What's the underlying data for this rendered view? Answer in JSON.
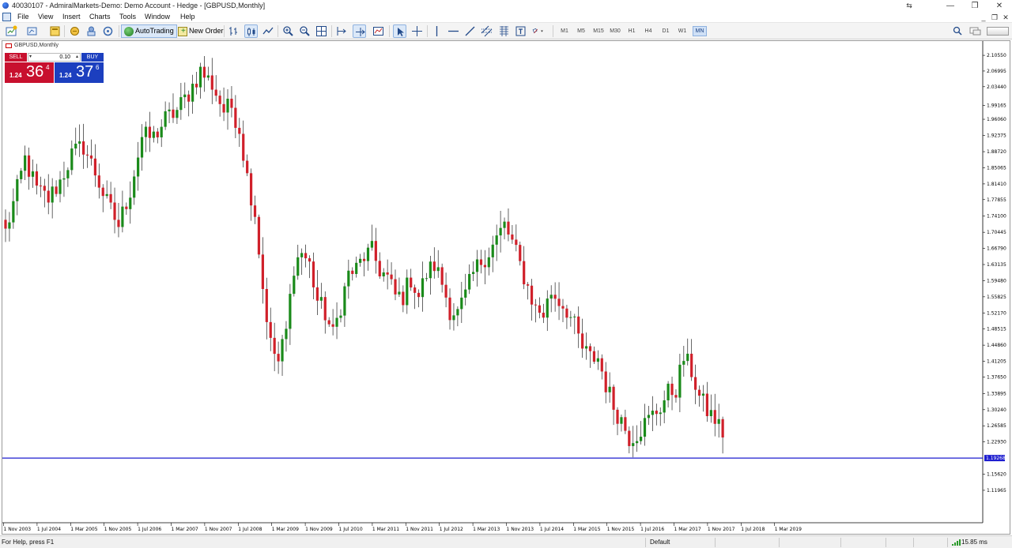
{
  "window": {
    "title": "40030107 - AdmiralMarkets-Demo: Demo Account - Hedge - [GBPUSD,Monthly]",
    "minimize": "—",
    "restore": "❐",
    "close": "✕"
  },
  "menu": {
    "items": [
      "File",
      "View",
      "Insert",
      "Charts",
      "Tools",
      "Window",
      "Help"
    ],
    "mdi_minimize": "_",
    "mdi_restore": "❐",
    "mdi_close": "✕"
  },
  "toolbar": {
    "autotrading_label": "AutoTrading",
    "new_order_label": "New Order",
    "timeframes": [
      "M1",
      "M5",
      "M15",
      "M30",
      "H1",
      "H4",
      "D1",
      "W1",
      "MN"
    ],
    "active_timeframe": "MN"
  },
  "chart_window": {
    "label": "GBPUSD,Monthly",
    "symbol": "GBPUSD",
    "period": "Monthly"
  },
  "one_click": {
    "sell_label": "SELL",
    "buy_label": "BUY",
    "lot": "0.10",
    "sell_price_small": "1.24",
    "sell_price_big": "36",
    "sell_price_sup": "4",
    "buy_price_small": "1.24",
    "buy_price_big": "37",
    "buy_price_sup": "6"
  },
  "chart_data": {
    "type": "candlestick",
    "y_ticks": [
      "2.10550",
      "2.06995",
      "2.03440",
      "1.99165",
      "1.96060",
      "1.92375",
      "1.88720",
      "1.85065",
      "1.81410",
      "1.77855",
      "1.74100",
      "1.70445",
      "1.66790",
      "1.63135",
      "1.59480",
      "1.55825",
      "1.52170",
      "1.48515",
      "1.44860",
      "1.41205",
      "1.37650",
      "1.33895",
      "1.30240",
      "1.26585",
      "1.22930",
      "1.15620",
      "1.11965"
    ],
    "ylim": [
      1.1034,
      2.1128
    ],
    "x_ticks": [
      "1 Nov 2003",
      "1 Jul 2004",
      "1 Mar 2005",
      "1 Nov 2005",
      "1 Jul 2006",
      "1 Mar 2007",
      "1 Nov 2007",
      "1 Jul 2008",
      "1 Mar 2009",
      "1 Nov 2009",
      "1 Jul 2010",
      "1 Mar 2011",
      "1 Nov 2011",
      "1 Jul 2012",
      "1 Mar 2013",
      "1 Nov 2013",
      "1 Jul 2014",
      "1 Mar 2015",
      "1 Nov 2015",
      "1 Jul 2016",
      "1 Mar 2017",
      "1 Nov 2017",
      "1 Jul 2018",
      "1 Mar 2019"
    ],
    "current_price": "1.19268",
    "current_price_value": 1.19268,
    "candle_count": 185,
    "anchor_closes": [
      [
        0,
        1.705
      ],
      [
        3,
        1.8
      ],
      [
        5,
        1.87
      ],
      [
        8,
        1.8
      ],
      [
        11,
        1.78
      ],
      [
        14,
        1.82
      ],
      [
        17,
        1.88
      ],
      [
        20,
        1.9
      ],
      [
        23,
        1.84
      ],
      [
        26,
        1.77
      ],
      [
        29,
        1.72
      ],
      [
        32,
        1.8
      ],
      [
        35,
        1.92
      ],
      [
        38,
        1.92
      ],
      [
        41,
        1.96
      ],
      [
        44,
        1.98
      ],
      [
        47,
        2.02
      ],
      [
        50,
        2.07
      ],
      [
        53,
        2.04
      ],
      [
        56,
        1.98
      ],
      [
        58,
        1.99
      ],
      [
        60,
        1.94
      ],
      [
        62,
        1.83
      ],
      [
        64,
        1.75
      ],
      [
        66,
        1.58
      ],
      [
        68,
        1.45
      ],
      [
        70,
        1.41
      ],
      [
        72,
        1.48
      ],
      [
        74,
        1.63
      ],
      [
        76,
        1.66
      ],
      [
        78,
        1.63
      ],
      [
        80,
        1.55
      ],
      [
        82,
        1.52
      ],
      [
        84,
        1.47
      ],
      [
        86,
        1.54
      ],
      [
        88,
        1.61
      ],
      [
        90,
        1.62
      ],
      [
        92,
        1.65
      ],
      [
        94,
        1.66
      ],
      [
        96,
        1.62
      ],
      [
        98,
        1.6
      ],
      [
        100,
        1.56
      ],
      [
        102,
        1.56
      ],
      [
        104,
        1.6
      ],
      [
        106,
        1.56
      ],
      [
        108,
        1.61
      ],
      [
        110,
        1.63
      ],
      [
        112,
        1.59
      ],
      [
        114,
        1.53
      ],
      [
        116,
        1.52
      ],
      [
        118,
        1.56
      ],
      [
        120,
        1.61
      ],
      [
        122,
        1.64
      ],
      [
        124,
        1.66
      ],
      [
        126,
        1.69
      ],
      [
        128,
        1.72
      ],
      [
        130,
        1.68
      ],
      [
        132,
        1.63
      ],
      [
        134,
        1.58
      ],
      [
        136,
        1.53
      ],
      [
        138,
        1.52
      ],
      [
        140,
        1.57
      ],
      [
        142,
        1.55
      ],
      [
        144,
        1.53
      ],
      [
        146,
        1.49
      ],
      [
        148,
        1.44
      ],
      [
        150,
        1.42
      ],
      [
        152,
        1.42
      ],
      [
        154,
        1.36
      ],
      [
        156,
        1.31
      ],
      [
        158,
        1.28
      ],
      [
        160,
        1.24
      ],
      [
        162,
        1.25
      ],
      [
        164,
        1.27
      ],
      [
        166,
        1.29
      ],
      [
        168,
        1.31
      ],
      [
        170,
        1.34
      ],
      [
        172,
        1.35
      ],
      [
        174,
        1.42
      ],
      [
        176,
        1.39
      ],
      [
        178,
        1.33
      ],
      [
        180,
        1.3
      ],
      [
        182,
        1.28
      ],
      [
        184,
        1.25
      ]
    ]
  }
}
